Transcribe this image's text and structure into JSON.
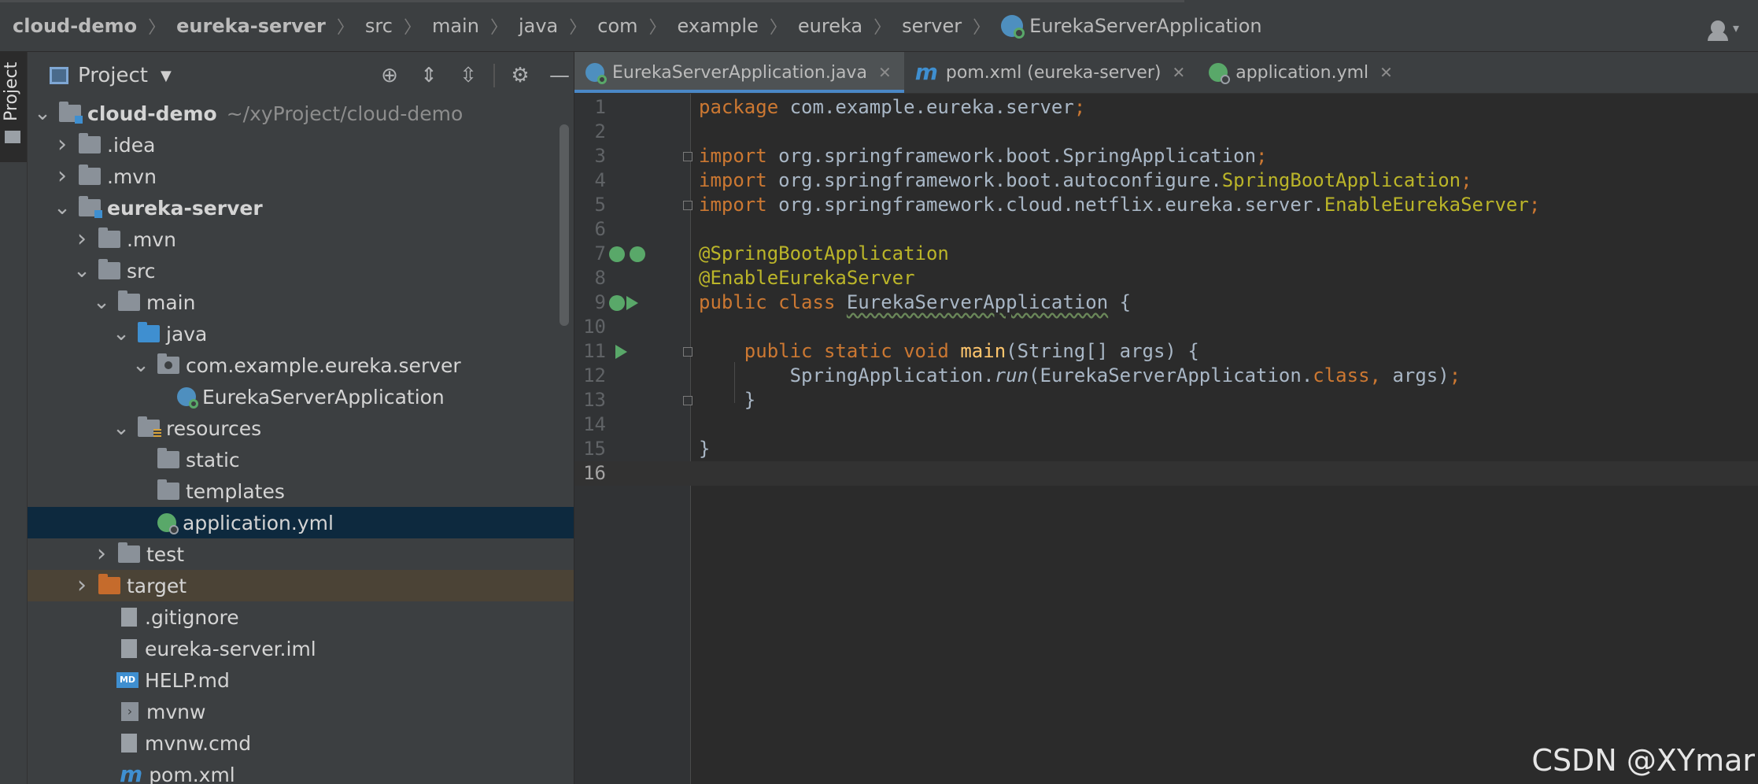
{
  "breadcrumbs": [
    {
      "label": "cloud-demo",
      "bold": true
    },
    {
      "label": "eureka-server",
      "bold": true
    },
    {
      "label": "src"
    },
    {
      "label": "main"
    },
    {
      "label": "java"
    },
    {
      "label": "com"
    },
    {
      "label": "example"
    },
    {
      "label": "eureka"
    },
    {
      "label": "server"
    },
    {
      "label": "EurekaServerApplication",
      "icon": "spring-boot-class-icon"
    }
  ],
  "tool_strip": {
    "label": "Project"
  },
  "project_panel": {
    "title": "Project",
    "tools": [
      "locate-icon",
      "expand-all-icon",
      "collapse-all-icon",
      "gear-icon",
      "minimize-icon"
    ],
    "tree": [
      {
        "depth": 0,
        "chevron": "down",
        "icon": "module-folder",
        "label": "cloud-demo",
        "bold": true,
        "path": "~/xyProject/cloud-demo"
      },
      {
        "depth": 1,
        "chevron": "right",
        "icon": "folder",
        "label": ".idea"
      },
      {
        "depth": 1,
        "chevron": "right",
        "icon": "folder",
        "label": ".mvn"
      },
      {
        "depth": 1,
        "chevron": "down",
        "icon": "module-folder",
        "label": "eureka-server",
        "bold": true
      },
      {
        "depth": 2,
        "chevron": "right",
        "icon": "folder",
        "label": ".mvn"
      },
      {
        "depth": 2,
        "chevron": "down",
        "icon": "folder",
        "label": "src"
      },
      {
        "depth": 3,
        "chevron": "down",
        "icon": "folder",
        "label": "main"
      },
      {
        "depth": 4,
        "chevron": "down",
        "icon": "source-folder",
        "label": "java"
      },
      {
        "depth": 5,
        "chevron": "down",
        "icon": "package",
        "label": "com.example.eureka.server"
      },
      {
        "depth": 6,
        "chevron": "none",
        "icon": "spring-class",
        "label": "EurekaServerApplication"
      },
      {
        "depth": 4,
        "chevron": "down",
        "icon": "resources-folder",
        "label": "resources"
      },
      {
        "depth": 5,
        "chevron": "none",
        "icon": "folder",
        "label": "static"
      },
      {
        "depth": 5,
        "chevron": "none",
        "icon": "folder",
        "label": "templates"
      },
      {
        "depth": 5,
        "chevron": "none",
        "icon": "spring-config",
        "label": "application.yml",
        "selected": true
      },
      {
        "depth": 3,
        "chevron": "right",
        "icon": "folder",
        "label": "test"
      },
      {
        "depth": 2,
        "chevron": "right",
        "icon": "excluded-folder",
        "label": "target",
        "excluded": true
      },
      {
        "depth": 3,
        "chevron": "none",
        "icon": "file",
        "label": ".gitignore"
      },
      {
        "depth": 3,
        "chevron": "none",
        "icon": "file",
        "label": "eureka-server.iml"
      },
      {
        "depth": 3,
        "chevron": "none",
        "icon": "markdown",
        "label": "HELP.md",
        "icon_text": "MD"
      },
      {
        "depth": 3,
        "chevron": "none",
        "icon": "terminal",
        "label": "mvnw",
        "icon_text": "›"
      },
      {
        "depth": 3,
        "chevron": "none",
        "icon": "file",
        "label": "mvnw.cmd"
      },
      {
        "depth": 3,
        "chevron": "none",
        "icon": "maven",
        "label": "pom.xml",
        "icon_text": "m"
      }
    ]
  },
  "tabs": [
    {
      "label": "EurekaServerApplication.java",
      "icon": "spring-class",
      "active": true
    },
    {
      "label": "pom.xml (eureka-server)",
      "icon": "maven",
      "icon_text": "m"
    },
    {
      "label": "application.yml",
      "icon": "spring-config"
    }
  ],
  "code": {
    "current_line": 16,
    "lines": [
      [
        {
          "t": "package ",
          "c": "kw"
        },
        {
          "t": "com.example.eureka.server"
        },
        {
          "t": ";",
          "c": "sem"
        }
      ],
      [],
      [
        {
          "t": "import ",
          "c": "kw"
        },
        {
          "t": "org.springframework.boot.SpringApplication"
        },
        {
          "t": ";",
          "c": "sem"
        }
      ],
      [
        {
          "t": "import ",
          "c": "kw"
        },
        {
          "t": "org.springframework.boot.autoconfigure."
        },
        {
          "t": "SpringBootApplication",
          "c": "ann"
        },
        {
          "t": ";",
          "c": "sem"
        }
      ],
      [
        {
          "t": "import ",
          "c": "kw"
        },
        {
          "t": "org.springframework.cloud.netflix.eureka.server."
        },
        {
          "t": "EnableEurekaServer",
          "c": "ann"
        },
        {
          "t": ";",
          "c": "sem"
        }
      ],
      [],
      [
        {
          "t": "@SpringBootApplication",
          "c": "ann"
        }
      ],
      [
        {
          "t": "@EnableEurekaServer",
          "c": "ann"
        }
      ],
      [
        {
          "t": "public class ",
          "c": "kw"
        },
        {
          "t": "EurekaServerApplication",
          "c": "und"
        },
        {
          "t": " {"
        }
      ],
      [],
      [
        {
          "t": "    "
        },
        {
          "t": "public static void ",
          "c": "kw"
        },
        {
          "t": "main",
          "c": "fn"
        },
        {
          "t": "(String[] args) {"
        }
      ],
      [
        {
          "t": "        SpringApplication."
        },
        {
          "t": "run",
          "c": "it"
        },
        {
          "t": "(EurekaServerApplication."
        },
        {
          "t": "class",
          "c": "kw"
        },
        {
          "t": ", ",
          "c": "kw"
        },
        {
          "t": "args)"
        },
        {
          "t": ";",
          "c": "sem"
        }
      ],
      [
        {
          "t": "    }"
        }
      ],
      [],
      [
        {
          "t": "}"
        }
      ],
      []
    ]
  },
  "watermark": "CSDN @XYmar",
  "colors": {
    "keyword": "#cc7832",
    "annotation": "#bbb529",
    "method": "#ffc66d",
    "selection": "#0d293e",
    "accent": "#4a88c7"
  }
}
